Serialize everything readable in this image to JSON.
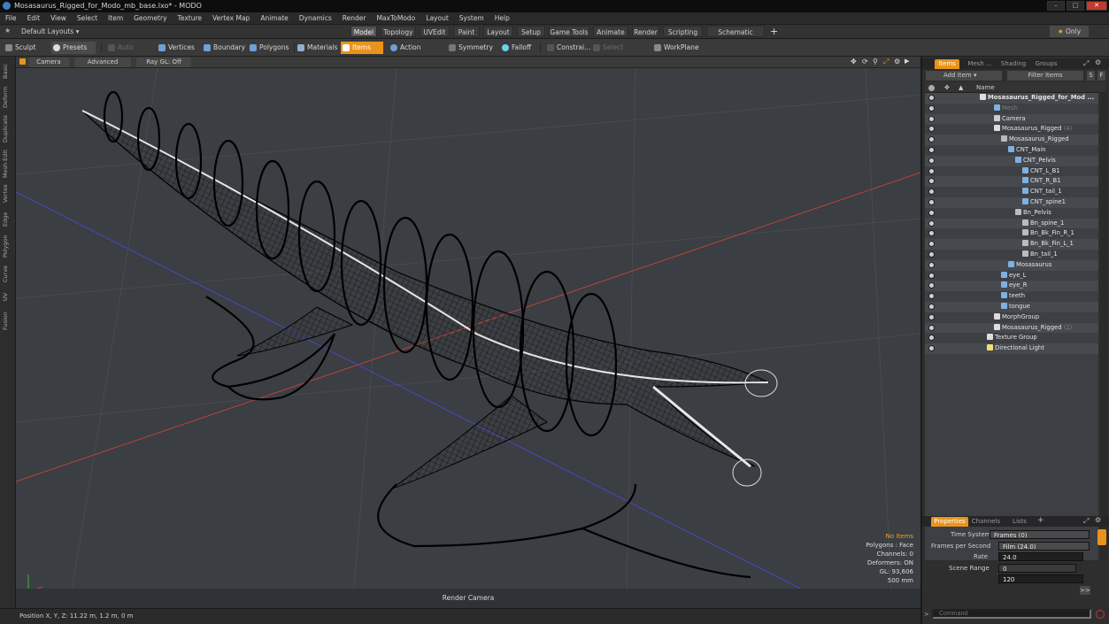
{
  "window": {
    "title": "Mosasaurus_Rigged_for_Modo_mb_base.lxo* - MODO"
  },
  "menu": [
    "File",
    "Edit",
    "View",
    "Select",
    "Item",
    "Geometry",
    "Texture",
    "Vertex Map",
    "Animate",
    "Dynamics",
    "Render",
    "MaxToModo",
    "Layout",
    "System",
    "Help"
  ],
  "layouts": {
    "dropdown": "Default Layouts",
    "tabs": [
      "Model",
      "Topology",
      "UVEdit",
      "Paint",
      "Layout",
      "Setup",
      "Game Tools",
      "Animate",
      "Render",
      "Scripting",
      "Schematic Fusion"
    ],
    "active": "Model",
    "only_label": "Only"
  },
  "toolbar": {
    "sculpt": "Sculpt",
    "presets": "Presets",
    "auto_select": "Auto Select",
    "vertices": "Vertices",
    "boundary": "Boundary",
    "polygons": "Polygons",
    "materials": "Materials",
    "items": "Items",
    "action_center": "Action Center",
    "symmetry": "Symmetry",
    "falloff": "Falloff",
    "constraints": "Constrai...",
    "select_through": "Select Through",
    "workplane": "WorkPlane"
  },
  "left_tabs": [
    "Basic",
    "Deform",
    "Duplicate",
    "Mesh Edit",
    "Vertex",
    "Edge",
    "Polygon",
    "Curve",
    "UV",
    "Fusion"
  ],
  "viewport": {
    "camera": "Camera",
    "shading": "Advanced",
    "raygl": "Ray GL: Off",
    "render_camera": "Render Camera",
    "status": {
      "no_items": "No Items",
      "polygons": "Polygons : Face",
      "channels": "Channels: 0",
      "deformers": "Deformers: ON",
      "gl": "GL: 93,606",
      "size": "500 mm"
    }
  },
  "statusbar": {
    "position": "Position X, Y, Z:   11.22 m, 1.2 m, 0 m"
  },
  "items_panel": {
    "tabs": [
      "Items",
      "Mesh ...",
      "Shading",
      "Groups"
    ],
    "add_item": "Add Item",
    "filter_items": "Filter Items",
    "col_name": "Name",
    "tree": [
      {
        "label": "Mosasaurus_Rigged_for_Mod ...",
        "indent": 0,
        "icon": "scene-icon",
        "bold": true
      },
      {
        "label": "Mesh",
        "indent": 2,
        "icon": "mesh-icon",
        "dim": true
      },
      {
        "label": "Camera",
        "indent": 2,
        "icon": "camera-icon"
      },
      {
        "label": "Mosasaurus_Rigged",
        "suffix": " (4)",
        "indent": 2,
        "icon": "group-icon"
      },
      {
        "label": "Mosasaurus_Rigged",
        "indent": 3,
        "icon": "locator-icon"
      },
      {
        "label": "CNT_Main",
        "indent": 4,
        "icon": "mesh-icon"
      },
      {
        "label": "CNT_Pelvis",
        "indent": 5,
        "icon": "mesh-icon"
      },
      {
        "label": "CNT_L_B1",
        "indent": 6,
        "icon": "mesh-icon"
      },
      {
        "label": "CNT_R_B1",
        "indent": 6,
        "icon": "mesh-icon"
      },
      {
        "label": "CNT_tail_1",
        "indent": 6,
        "icon": "mesh-icon"
      },
      {
        "label": "CNT_spine1",
        "indent": 6,
        "icon": "mesh-icon"
      },
      {
        "label": "Bn_Pelvis",
        "indent": 5,
        "icon": "bone-icon"
      },
      {
        "label": "Bn_spine_1",
        "indent": 6,
        "icon": "bone-icon"
      },
      {
        "label": "Bn_Bk_Fin_R_1",
        "indent": 6,
        "icon": "bone-icon"
      },
      {
        "label": "Bn_Bk_Fin_L_1",
        "indent": 6,
        "icon": "bone-icon"
      },
      {
        "label": "Bn_tail_1",
        "indent": 6,
        "icon": "bone-icon"
      },
      {
        "label": "Mosasaurus",
        "indent": 4,
        "icon": "mesh-icon"
      },
      {
        "label": "eye_L",
        "indent": 3,
        "icon": "mesh-icon"
      },
      {
        "label": "eye_R",
        "indent": 3,
        "icon": "mesh-icon"
      },
      {
        "label": "teeth",
        "indent": 3,
        "icon": "mesh-icon"
      },
      {
        "label": "tongue",
        "indent": 3,
        "icon": "mesh-icon"
      },
      {
        "label": "MorphGroup",
        "indent": 2,
        "icon": "group-icon"
      },
      {
        "label": "Mosasaurus_Rigged",
        "suffix": " (2)",
        "indent": 2,
        "icon": "group-icon"
      },
      {
        "label": "Texture Group",
        "indent": 1,
        "icon": "group-icon"
      },
      {
        "label": "Directional Light",
        "indent": 1,
        "icon": "light-icon"
      }
    ]
  },
  "properties_panel": {
    "tabs": [
      "Properties",
      "Channels",
      "Lists"
    ],
    "time_system_label": "Time System",
    "time_system_value": "Frames (0)",
    "fps_label": "Frames per Second",
    "fps_value": "Film (24.0)",
    "rate_label": "Rate",
    "rate_value": "24.0",
    "scene_range_label": "Scene Range",
    "scene_start": "0",
    "scene_end": "120",
    "command_placeholder": "Command"
  },
  "colors": {
    "accent": "#e8941c",
    "viewport_bg": "#3b3e42",
    "x_axis": "#c0433a",
    "z_axis": "#4747c8"
  }
}
